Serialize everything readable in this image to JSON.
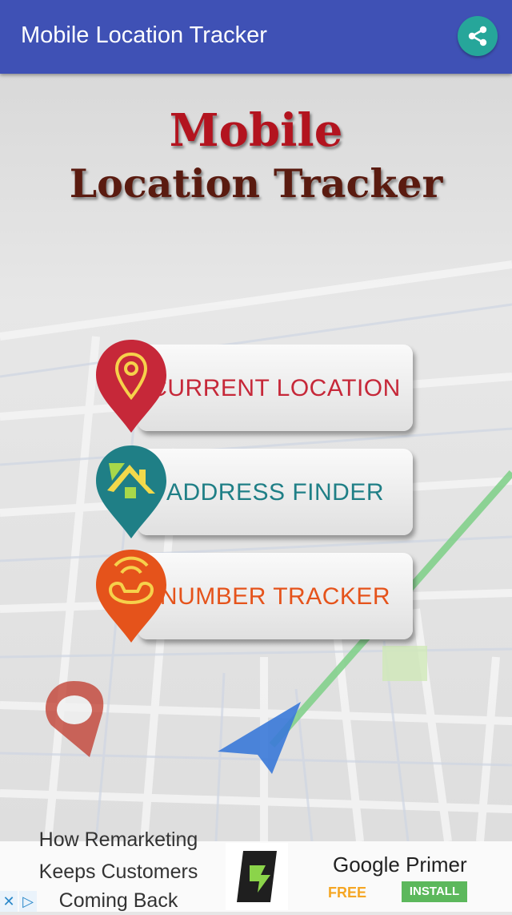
{
  "appbar": {
    "title": "Mobile Location Tracker",
    "share_icon": "share-icon"
  },
  "logo": {
    "line1": "Mobile",
    "line2": "Location Tracker"
  },
  "menu": [
    {
      "label": "CURRENT LOCATION",
      "icon": "location-pin-icon",
      "color": "#c62839"
    },
    {
      "label": "ADDRESS FINDER",
      "icon": "home-address-icon",
      "color": "#1f7f86"
    },
    {
      "label": "NUMBER TRACKER",
      "icon": "phone-signal-icon",
      "color": "#e5531b"
    }
  ],
  "ad": {
    "line1": "How Remarketing",
    "line2": "Keeps Customers",
    "line3": "Coming Back",
    "app_name": "Google Primer",
    "price": "FREE",
    "install": "INSTALL"
  }
}
